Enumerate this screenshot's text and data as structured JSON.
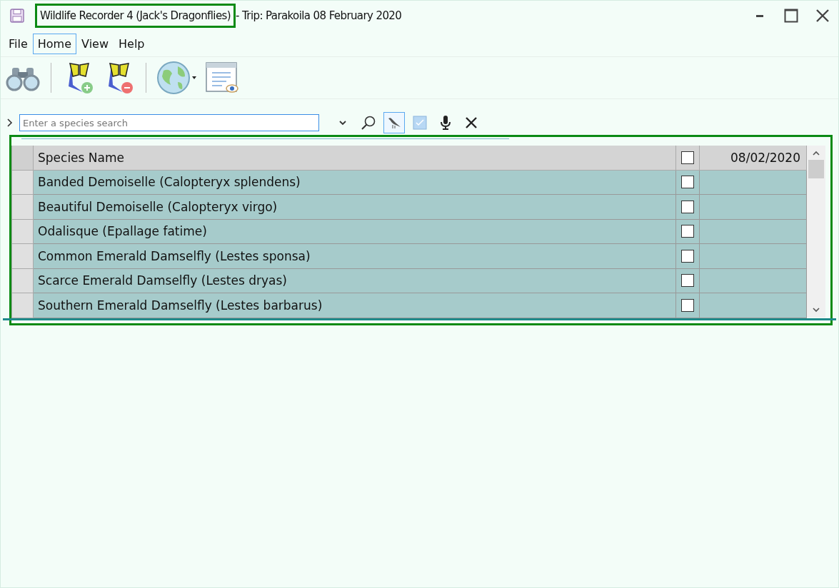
{
  "window": {
    "title": "Wildlife Recorder 4 (Jack's Dragonflies)",
    "subtitle": "- Trip: Parakoila 08 February 2020"
  },
  "menu": [
    {
      "label": "File",
      "selected": false
    },
    {
      "label": "Home",
      "selected": true
    },
    {
      "label": "View",
      "selected": false
    },
    {
      "label": "Help",
      "selected": false
    }
  ],
  "search": {
    "placeholder": "Enter a species search",
    "bird_filter_selected": true
  },
  "table": {
    "columns": [
      "Species Name",
      "08/02/2020"
    ],
    "header_checked": false,
    "rows": [
      {
        "name": "Banded Demoiselle (Calopteryx splendens)",
        "checked": false
      },
      {
        "name": "Beautiful Demoiselle (Calopteryx virgo)",
        "checked": false
      },
      {
        "name": "Odalisque (Epallage fatime)",
        "checked": false
      },
      {
        "name": "Common Emerald Damselfly (Lestes sponsa)",
        "checked": false
      },
      {
        "name": "Scarce Emerald Damselfly (Lestes dryas)",
        "checked": false
      },
      {
        "name": "Southern Emerald Damselfly (Lestes barbarus)",
        "checked": false
      }
    ]
  }
}
